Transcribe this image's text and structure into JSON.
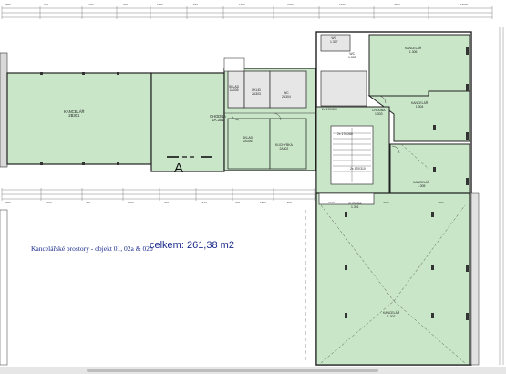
{
  "caption": "Kancelářské prostory - objekt 01, 02a & 02b",
  "total_area": "celkem: 261,38 m2",
  "section_marker": "A",
  "rooms": {
    "kancelar_main": {
      "name": "KANCELÁŘ",
      "code": "2B301"
    },
    "chodba_left": {
      "name": "CHODBA",
      "code": "2A.301"
    },
    "sklad_a": {
      "name": "SKLAD",
      "code": "2A305"
    },
    "uklid": {
      "name": "ÚKLID",
      "code": "2A303"
    },
    "wc_a": {
      "name": "WC",
      "code": "2A304"
    },
    "sklad_b": {
      "name": "SKLAD",
      "code": "2A306"
    },
    "kuchynka": {
      "name": "KUCHYŇKA",
      "code": "2A302"
    },
    "chodba_right": {
      "name": "CHODBA",
      "code": "1.303"
    },
    "chodba_lower": {
      "name": "CHODBA",
      "code": "1.301"
    },
    "kancelar_1306": {
      "name": "KANCELÁŘ",
      "code": "1.306"
    },
    "kancelar_1304": {
      "name": "KANCELÁŘ",
      "code": "1.304"
    },
    "kancelar_1305": {
      "name": "KANCELÁŘ",
      "code": "1.305"
    },
    "kancelar_1302": {
      "name": "KANCELÁŘ",
      "code": "1.302"
    },
    "wc_b": {
      "name": "WC",
      "code": "1.307"
    },
    "wc_c": {
      "name": "WC",
      "code": "1.308"
    }
  },
  "stair_labels": [
    "2x 170/300",
    "2x 170/260",
    "2x 170/310"
  ],
  "top_dims": [
    "4750",
    "380",
    "1000",
    "700",
    "1640",
    "840",
    "1300",
    "3150",
    "1900",
    "2900",
    "15990"
  ],
  "mid_dims": [
    "4750",
    "1900",
    "700",
    "1000",
    "700",
    "1640",
    "700",
    "1540",
    "500",
    "3120",
    "2090",
    "4350"
  ]
}
